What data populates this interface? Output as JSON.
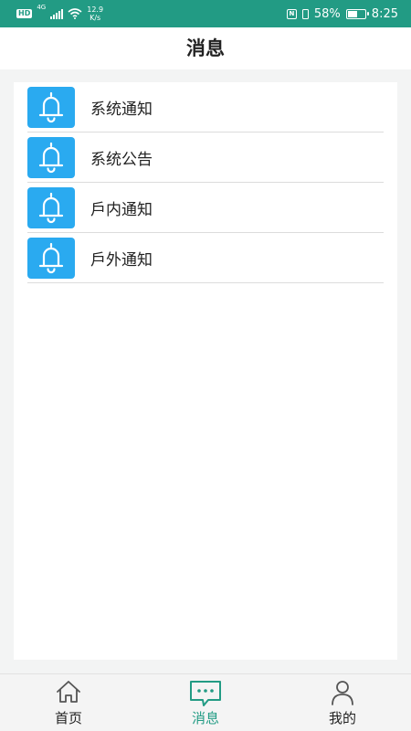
{
  "status_bar": {
    "hd": "HD",
    "net": "4G",
    "speed_value": "12.9",
    "speed_unit": "K/s",
    "nfc": "N",
    "battery": "58%",
    "battery_level": 0.58,
    "time": "8:25"
  },
  "header": {
    "title": "消息"
  },
  "list": {
    "items": [
      {
        "label": "系统通知",
        "icon": "bell-icon"
      },
      {
        "label": "系统公告",
        "icon": "bell-icon"
      },
      {
        "label": "戶内通知",
        "icon": "bell-icon"
      },
      {
        "label": "戶外通知",
        "icon": "bell-icon"
      }
    ]
  },
  "tabbar": {
    "tabs": [
      {
        "label": "首页",
        "icon": "home-icon"
      },
      {
        "label": "消息",
        "icon": "message-icon",
        "active": true
      },
      {
        "label": "我的",
        "icon": "user-icon"
      }
    ]
  },
  "colors": {
    "accent": "#229b84",
    "bell_bg": "#2aaaf0"
  }
}
